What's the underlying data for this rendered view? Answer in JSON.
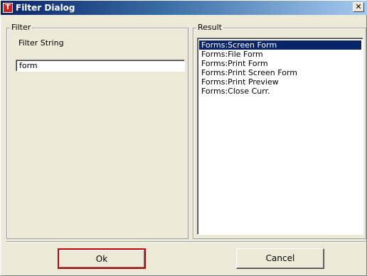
{
  "window": {
    "title": "Filter Dialog",
    "icon_letter": "T",
    "close_glyph": "✕"
  },
  "filter": {
    "group_label": "Filter",
    "field_label": "Filter String",
    "input_value": "form"
  },
  "result": {
    "group_label": "Result",
    "items": [
      {
        "label": "Forms:Screen Form",
        "selected": true
      },
      {
        "label": "Forms:File Form",
        "selected": false
      },
      {
        "label": "Forms:Print Form",
        "selected": false
      },
      {
        "label": "Forms:Print Screen Form",
        "selected": false
      },
      {
        "label": "Forms:Print Preview",
        "selected": false
      },
      {
        "label": "Forms:Close Curr.",
        "selected": false
      }
    ]
  },
  "buttons": {
    "ok_label": "Ok",
    "cancel_label": "Cancel"
  },
  "colors": {
    "title_bar": "#0a246a",
    "selection": "#0a246a",
    "dialog_bg": "#ece9d8",
    "ok_focus_border": "#c00000"
  }
}
